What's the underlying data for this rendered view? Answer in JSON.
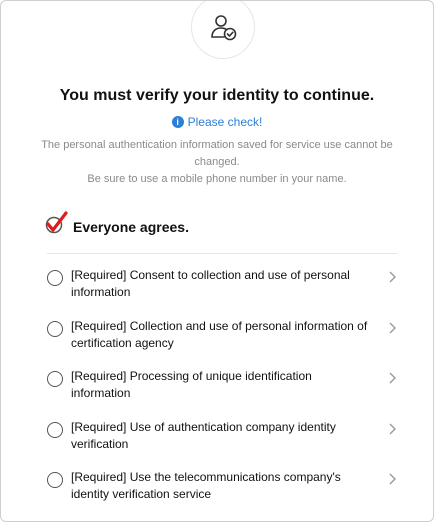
{
  "header": {
    "icon": "user-verified-icon",
    "title": "You must verify your identity to continue.",
    "notice": "Please check!",
    "notice_icon": "info-icon",
    "description_line1": "The personal authentication information saved for service use cannot be changed.",
    "description_line2": "Be sure to use a mobile phone number in your name."
  },
  "agree_all": {
    "label": "Everyone agrees.",
    "checked": true,
    "mark_color": "#e01b1b"
  },
  "items": [
    {
      "label": "[Required] Consent to collection and use of personal information",
      "checked": false
    },
    {
      "label": "[Required] Collection and use of personal information of certification agency",
      "checked": false
    },
    {
      "label": "[Required] Processing of unique identification information",
      "checked": false
    },
    {
      "label": "[Required] Use of authentication company identity verification",
      "checked": false
    },
    {
      "label": "[Required] Use the telecommunications company's identity verification service",
      "checked": false
    }
  ],
  "colors": {
    "accent_blue": "#2c7fd6",
    "muted_text": "#8a8a8a"
  }
}
